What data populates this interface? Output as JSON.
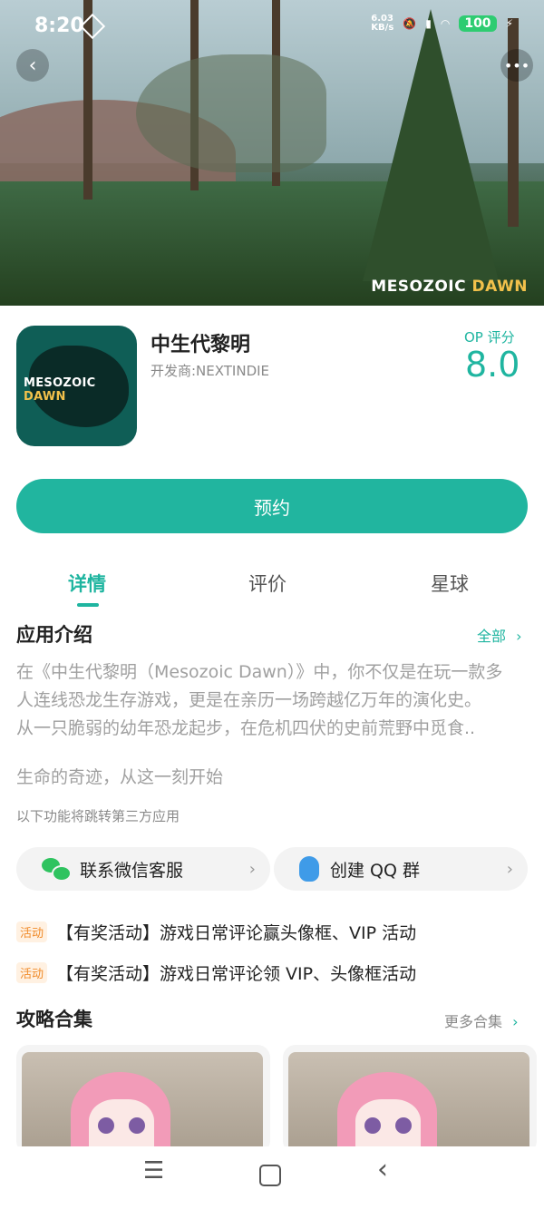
{
  "status_bar": {
    "time": "8:20",
    "net_speed": "6.03\nKB/s",
    "battery": "100"
  },
  "hero": {
    "watermark_a": "MESOZOIC ",
    "watermark_b": "DAWN"
  },
  "app": {
    "icon_logo_a": "MESOZOIC ",
    "icon_logo_b": "DAWN",
    "name": "中生代黎明",
    "developer": "开发商:NEXTINDIE",
    "score_label": "OP 评分",
    "score": "8.0"
  },
  "reserve_button": "预约",
  "tabs": [
    {
      "label": "详情",
      "active": true
    },
    {
      "label": "评价",
      "active": false
    },
    {
      "label": "星球",
      "active": false
    }
  ],
  "intro": {
    "title": "应用介绍",
    "all_link": "全部",
    "lines": [
      "在《中生代黎明（Mesozoic Dawn）》中，你不仅是在玩一款多",
      "人连线恐龙生存游戏，更是在亲历一场跨越亿万年的演化史。",
      "从一只脆弱的幼年恐龙起步，在危机四伏的史前荒野中觅食.."
    ],
    "slogan": "生命的奇迹，从这一刻开始",
    "note": "以下功能将跳转第三方应用"
  },
  "links": {
    "wechat": "联系微信客服",
    "qq": "创建 QQ 群"
  },
  "activities": [
    {
      "badge": "活动",
      "text": "【有奖活动】游戏日常评论赢头像框、VIP 活动"
    },
    {
      "badge": "活动",
      "text": "【有奖活动】游戏日常评论领 VIP、头像框活动"
    }
  ],
  "guides": {
    "title": "攻略合集",
    "more": "更多合集"
  },
  "colors": {
    "accent": "#21b59f",
    "badge": "#f08a28"
  },
  "icons": [
    "back-icon",
    "more-icon",
    "wechat-icon",
    "qq-icon",
    "chevron-right-icon",
    "menu-icon",
    "home-icon",
    "nav-back-icon"
  ]
}
